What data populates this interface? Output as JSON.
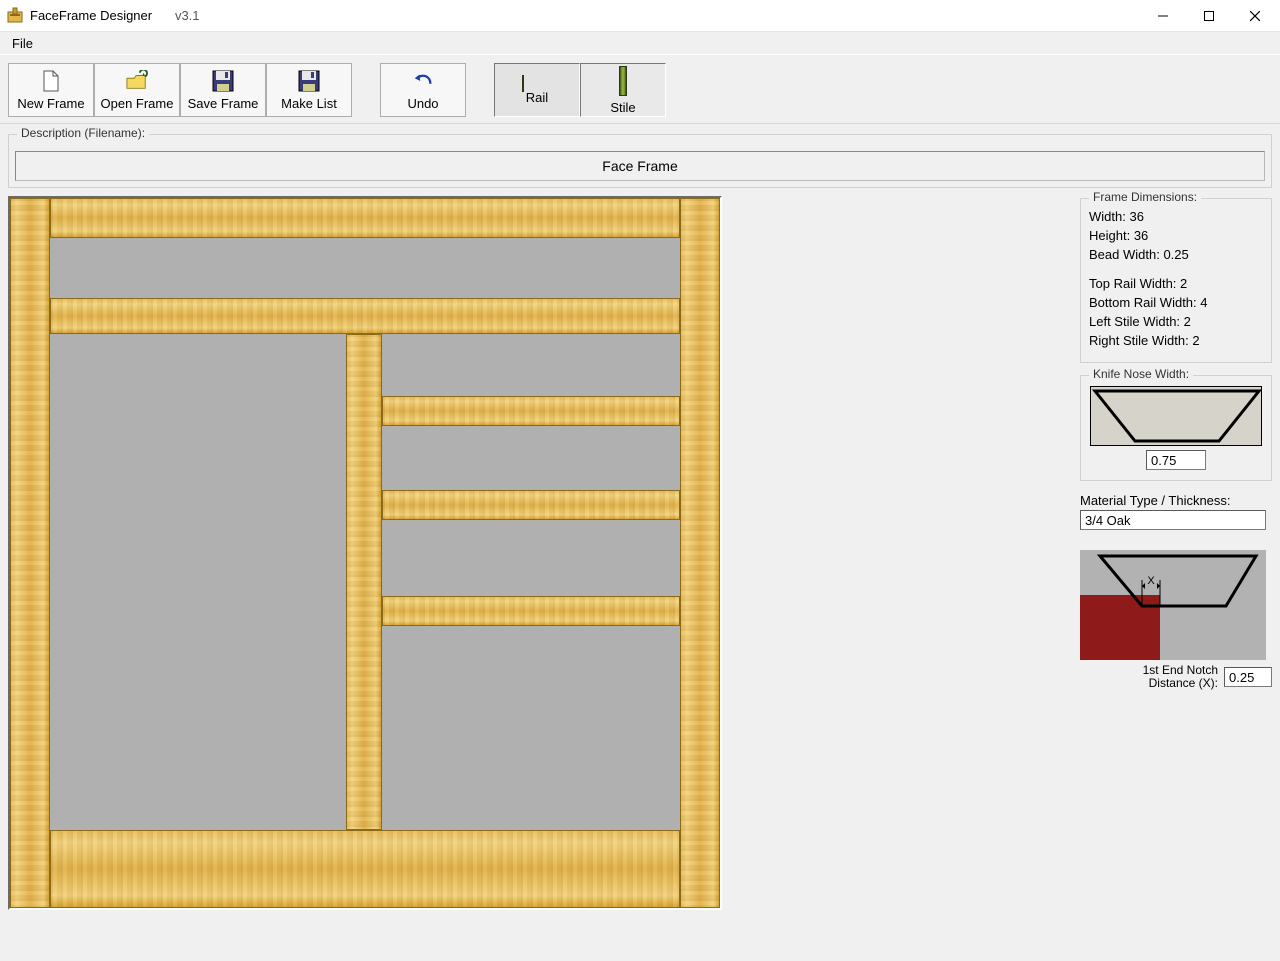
{
  "app": {
    "title": "FaceFrame Designer",
    "version": "v3.1"
  },
  "menubar": {
    "items": [
      "File"
    ]
  },
  "toolbar": {
    "new_frame": "New Frame",
    "open_frame": "Open Frame",
    "save_frame": "Save Frame",
    "make_list": "Make List",
    "undo": "Undo",
    "rail": "Rail",
    "stile": "Stile"
  },
  "description": {
    "legend": "Description (Filename):",
    "value": "Face Frame"
  },
  "dimensions_panel": {
    "legend": "Frame Dimensions:",
    "width_label": "Width:",
    "width_value": "36",
    "height_label": "Height:",
    "height_value": "36",
    "bead_label": "Bead Width:",
    "bead_value": "0.25",
    "top_rail_label": "Top Rail Width:",
    "top_rail_value": "2",
    "bottom_rail_label": "Bottom Rail Width:",
    "bottom_rail_value": "4",
    "left_stile_label": "Left Stile Width:",
    "left_stile_value": "2",
    "right_stile_label": "Right Stile Width:",
    "right_stile_value": "2"
  },
  "knife_panel": {
    "legend": "Knife Nose Width:",
    "value": "0.75"
  },
  "material": {
    "label": "Material Type / Thickness:",
    "value": "3/4 Oak"
  },
  "notch": {
    "label_line1": "1st End Notch",
    "label_line2": "Distance (X):",
    "annotation": "X",
    "value": "0.25"
  }
}
